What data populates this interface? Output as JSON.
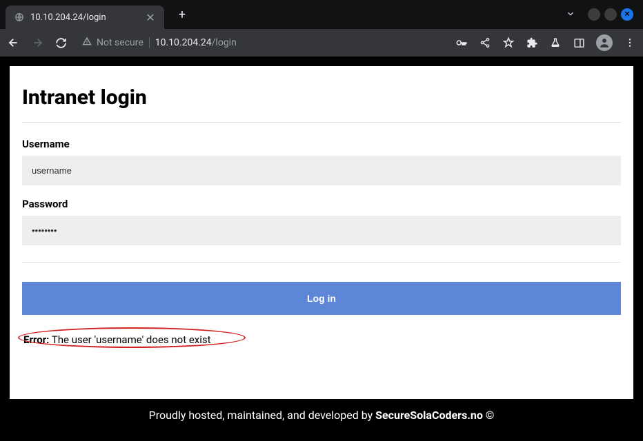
{
  "browser": {
    "tab_title": "10.10.204.24/login",
    "not_secure_label": "Not secure",
    "url_host": "10.10.204.24",
    "url_path": "/login"
  },
  "page": {
    "title": "Intranet login",
    "username_label": "Username",
    "username_value": "username",
    "password_label": "Password",
    "password_value": "••••••••",
    "login_button": "Log in",
    "error_label": "Error:",
    "error_message": " The user 'username' does not exist"
  },
  "footer": {
    "prefix": "Proudly hosted, maintained, and developed by ",
    "brand": "SecureSolaCoders.no ©"
  }
}
